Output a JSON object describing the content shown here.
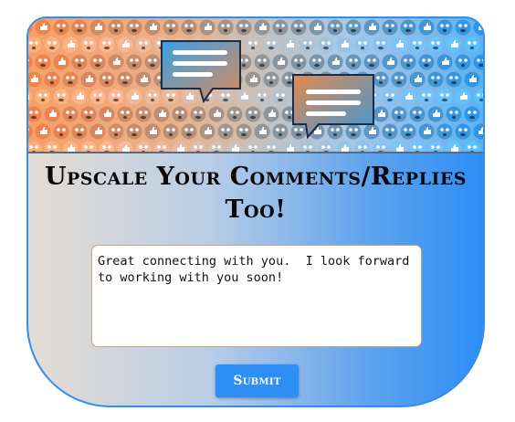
{
  "banner": {
    "icon": "emoji-pattern-with-speech-bubbles",
    "colors": {
      "left": "#f08a4b",
      "right": "#3aa0ee",
      "bubble_front": "#3d97d8",
      "bubble_back": "#e08a55"
    }
  },
  "form": {
    "title": "Upscale Your Comments/Replies Too!",
    "comment_value": "Great connecting with you.  I look forward to working with you soon!",
    "submit_label": "Submit"
  },
  "colors": {
    "accent": "#2d8ef5",
    "card_gradient_start": "#e5ddd3",
    "card_gradient_end": "#2d8ef5",
    "textarea_border": "#c9a27a"
  }
}
